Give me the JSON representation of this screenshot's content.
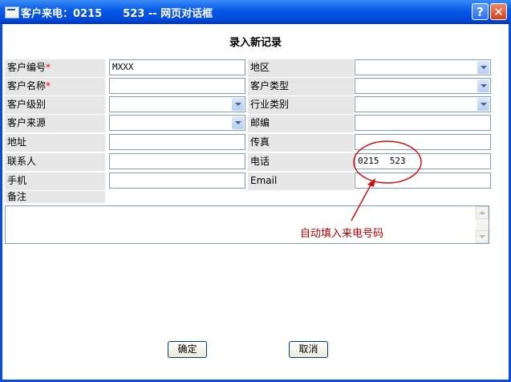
{
  "titlebar": {
    "title": "客户来电：0215  523 -- 网页对话框",
    "help_label": "?",
    "close_label": "✕"
  },
  "form": {
    "title": "录入新记录",
    "customer_id_label": "客户编号",
    "customer_id_value": "MXXX",
    "region_label": "地区",
    "customer_name_label": "客户名称",
    "customer_type_label": "客户类型",
    "customer_level_label": "客户级别",
    "industry_label": "行业类别",
    "customer_source_label": "客户来源",
    "postcode_label": "邮编",
    "address_label": "地址",
    "fax_label": "传真",
    "contact_label": "联系人",
    "phone_label": "电话",
    "phone_value": "0215  523",
    "mobile_label": "手机",
    "email_label": "Email",
    "notes_label": "备注",
    "required_mark": "*"
  },
  "buttons": {
    "ok_label": "确定",
    "cancel_label": "取消"
  },
  "annotation": {
    "text": "自动填入来电号码",
    "color": "#c00000"
  }
}
